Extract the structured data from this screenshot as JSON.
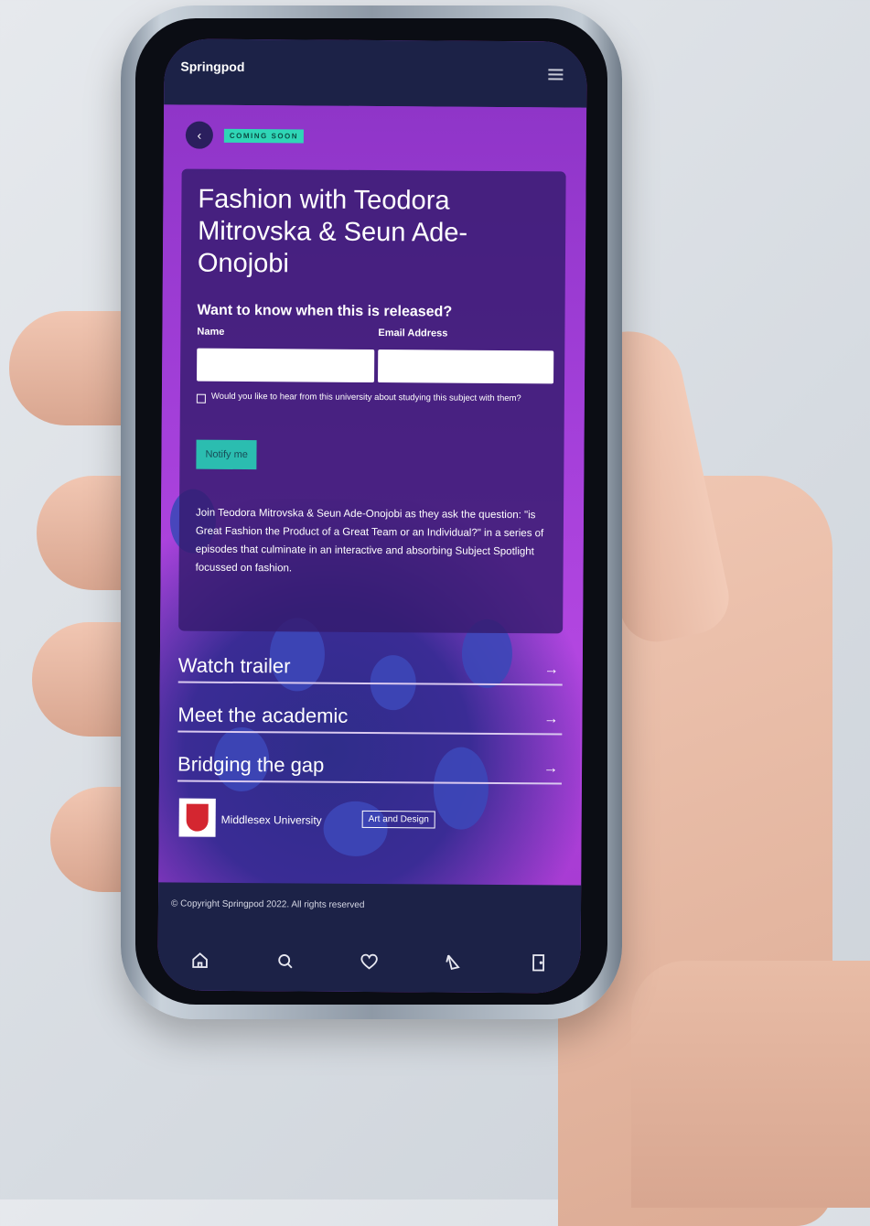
{
  "app": {
    "logo": "Springpod"
  },
  "badge": "COMING SOON",
  "course": {
    "title": "Fashion with Teodora Mitrovska & Seun Ade-Onojobi",
    "notify_heading": "Want to know when this is released?",
    "name_label": "Name",
    "email_label": "Email Address",
    "consent_text": "Would you like to hear from this university about studying this subject with them?",
    "notify_button": "Notify me",
    "description": "Join Teodora Mitrovska & Seun Ade-Onojobi as they ask the question: \"is Great Fashion the Product of a Great Team or an Individual?\" in a series of episodes that culminate in an interactive and absorbing Subject Spotlight focussed on fashion."
  },
  "links": [
    {
      "label": "Watch trailer",
      "arrow": "→"
    },
    {
      "label": "Meet the academic",
      "arrow": "→"
    },
    {
      "label": "Bridging the gap",
      "arrow": "→"
    }
  ],
  "university": {
    "name": "Middlesex University",
    "tag": "Art and Design"
  },
  "footer": {
    "copyright": "© Copyright Springpod 2022. All rights reserved"
  },
  "nav": {
    "home": "home-icon",
    "search": "search-icon",
    "favourites": "heart-icon",
    "explore": "rocket-icon",
    "logout": "door-icon"
  },
  "colors": {
    "header": "#1c2247",
    "accent": "#2fd6b6",
    "hero": "#a33fd9"
  }
}
